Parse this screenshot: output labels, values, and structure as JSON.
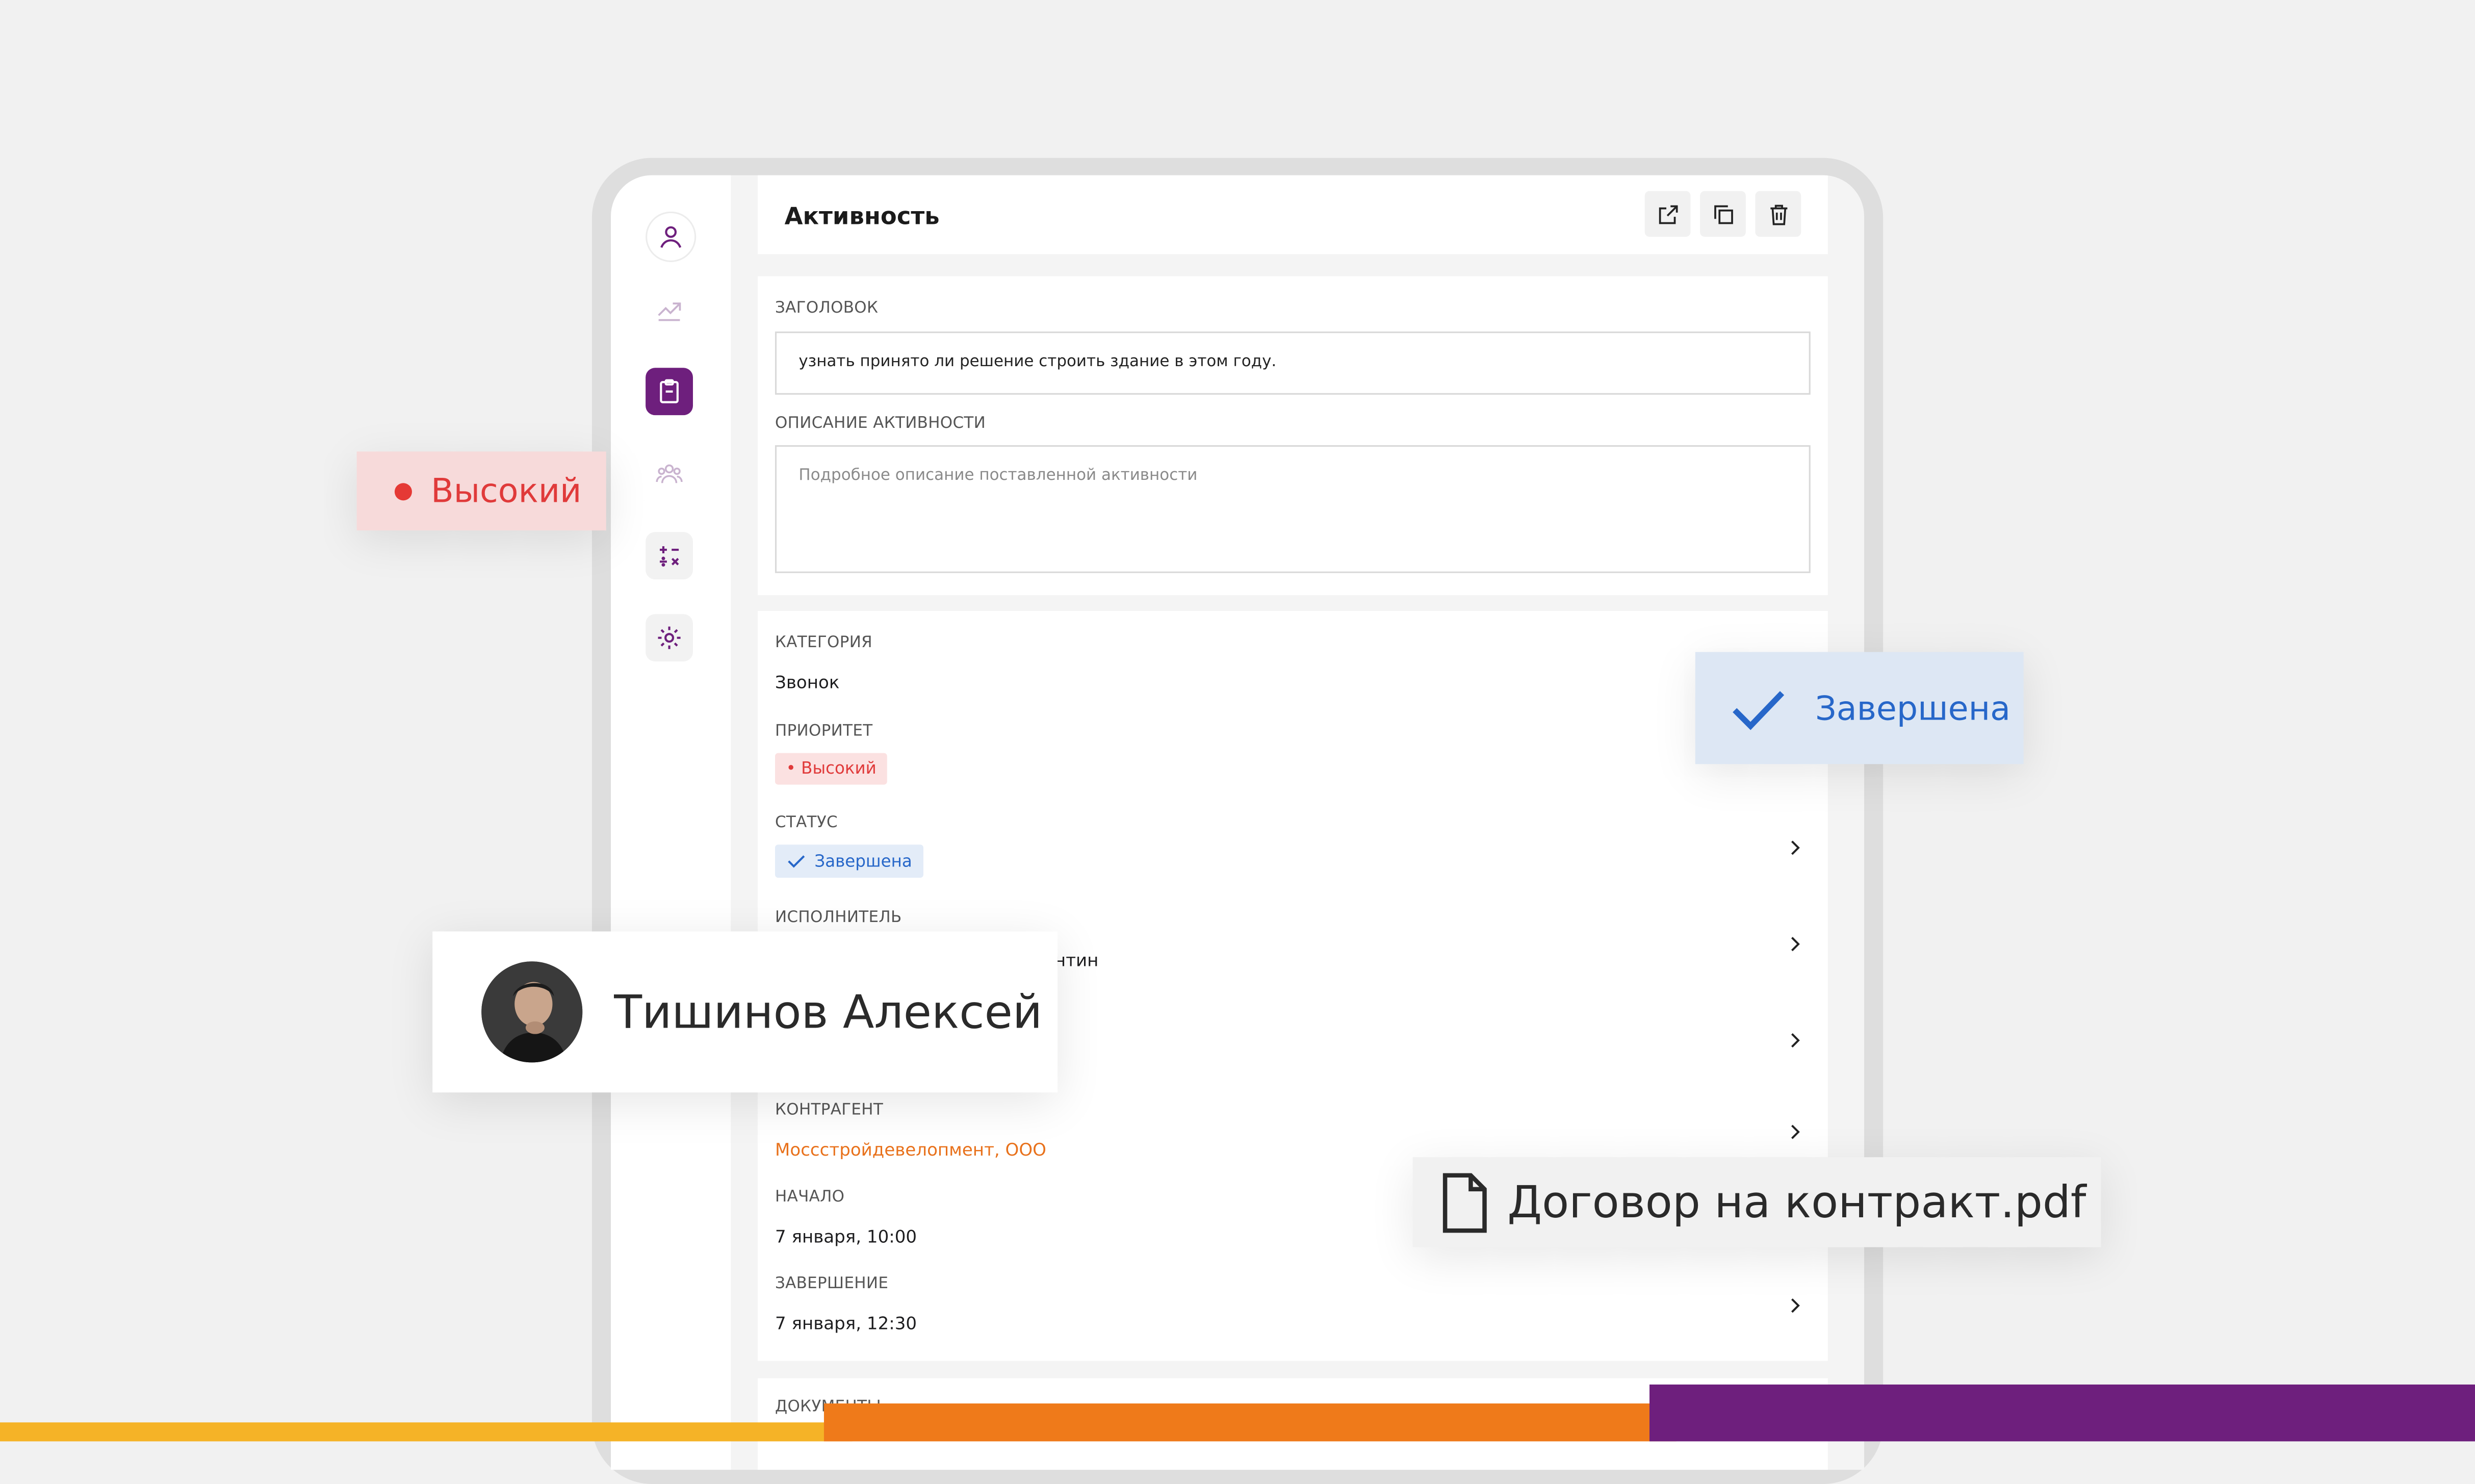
{
  "header": {
    "title": "Активность"
  },
  "sidebar": {
    "items": [
      {
        "icon": "user-icon"
      },
      {
        "icon": "chart-icon"
      },
      {
        "icon": "clipboard-icon",
        "active": true
      },
      {
        "icon": "team-icon"
      },
      {
        "icon": "calculator-icon"
      },
      {
        "icon": "settings-icon"
      }
    ]
  },
  "form": {
    "title_label": "ЗАГОЛОВОК",
    "title_value": "узнать принято ли решение строить здание в этом году.",
    "description_label": "ОПИСАНИЕ АКТИВНОСТИ",
    "description_placeholder": "Подробное описание поставленной активности"
  },
  "details": {
    "category_label": "КАТЕГОРИЯ",
    "category_value": "Звонок",
    "priority_label": "ПРИОРИТЕТ",
    "priority_value": "• Высокий",
    "status_label": "СТАТУС",
    "status_value": "Завершена",
    "assignee_label": "ИСПОЛНИТЕЛЬ",
    "assignee_value_partial": "нтин",
    "counterparty_label": "КОНТРАГЕНТ",
    "counterparty_value": "Моссстройдевелопмент, ООО",
    "start_label": "НАЧАЛО",
    "start_value": "7 января, 10:00",
    "end_label": "ЗАВЕРШЕНИЕ",
    "end_value": "7 января, 12:30",
    "documents_label": "ДОКУМЕНТЫ"
  },
  "overlays": {
    "priority": "Высокий",
    "status": "Завершена",
    "user_name": "Тишинов Алексей",
    "file_name": "Договор на контракт.pdf"
  },
  "colors": {
    "accent_purple": "#6e1f7d",
    "priority_red": "#e03a3a",
    "status_blue": "#2767c9",
    "orange": "#e8711b",
    "bar_yellow": "#f5b327",
    "bar_orange": "#ef7a1a",
    "bar_purple": "#6e1f7d"
  }
}
